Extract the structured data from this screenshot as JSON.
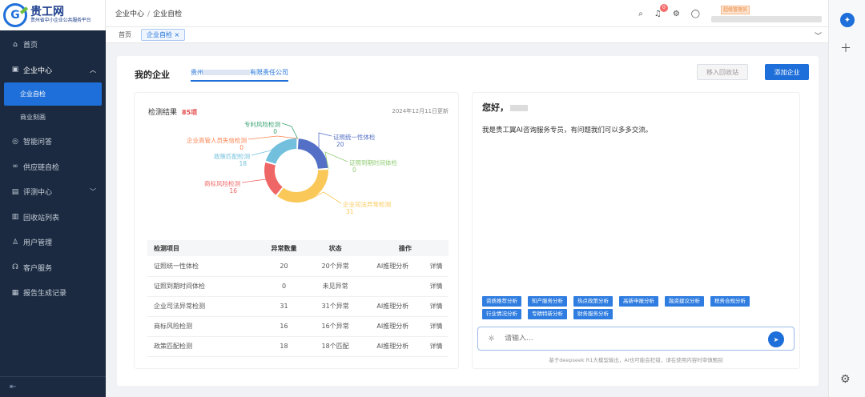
{
  "app": {
    "logo_title": "贵工网",
    "logo_sub": "贵州省中小企业公共服务平台"
  },
  "sidebar": {
    "items": [
      {
        "label": "首页",
        "icon": "home-icon"
      },
      {
        "label": "企业中心",
        "icon": "briefcase-icon"
      },
      {
        "label": "企业自检",
        "icon": ""
      },
      {
        "label": "商业刻画",
        "icon": ""
      },
      {
        "label": "智能问答",
        "icon": "chat-icon"
      },
      {
        "label": "供应链自检",
        "icon": "link-icon"
      },
      {
        "label": "评测中心",
        "icon": "document-icon"
      },
      {
        "label": "回收站列表",
        "icon": "trash-icon"
      },
      {
        "label": "用户管理",
        "icon": "user-icon"
      },
      {
        "label": "客户服务",
        "icon": "headset-icon"
      },
      {
        "label": "报告生成记录",
        "icon": "report-icon"
      }
    ]
  },
  "topbar": {
    "breadcrumb": [
      "企业中心",
      "企业自检"
    ],
    "notification_count": "0",
    "role": "超级管理员"
  },
  "tabs": [
    "首页",
    "企业自检"
  ],
  "main": {
    "section_title": "我的企业",
    "company_prefix": "贵州",
    "company_suffix": "有限责任公司",
    "recycle_btn": "移入回收站",
    "add_btn": "添加企业"
  },
  "result": {
    "title": "检测结果",
    "total": "85项",
    "updated": "2024年12月11日更新",
    "table_headers": [
      "检测项目",
      "异常数量",
      "状态",
      "操作"
    ],
    "rows": [
      {
        "item": "证照统一性体检",
        "count": "20",
        "status": "20个异常",
        "status_type": "red",
        "action": "AI推理分析",
        "detail": "详情"
      },
      {
        "item": "证照到期时间体检",
        "count": "0",
        "status": "未见异常",
        "status_type": "green",
        "action": "",
        "detail": "详情"
      },
      {
        "item": "企业司法异常检测",
        "count": "31",
        "status": "31个异常",
        "status_type": "red",
        "action": "AI推理分析",
        "detail": "详情"
      },
      {
        "item": "商标风险检测",
        "count": "16",
        "status": "16个异常",
        "status_type": "red",
        "action": "AI推理分析",
        "detail": "详情"
      },
      {
        "item": "政策匹配检测",
        "count": "18",
        "status": "18个匹配",
        "status_type": "red",
        "action": "AI推理分析",
        "detail": "详情"
      }
    ]
  },
  "chart_data": {
    "type": "pie",
    "subtype": "donut",
    "categories": [
      "证照统一性体检",
      "证照到期时间体检",
      "企业司法异常检测",
      "商标风险检测",
      "政策匹配检测",
      "企业高管人员失信检测",
      "专利风险检测"
    ],
    "values": [
      20,
      0,
      31,
      16,
      18,
      0,
      0
    ],
    "colors": [
      "#5470c6",
      "#91cc75",
      "#fac858",
      "#ee6666",
      "#73c0de",
      "#fc8452",
      "#3ba272"
    ]
  },
  "assistant": {
    "greeting": "您好，",
    "intro": "我是贵工翼AI咨询服务专员，有问题我们可以多多交流。",
    "chips": [
      "资质推荐分析",
      "知产服务分析",
      "热点政策分析",
      "高新申报分析",
      "融资建议分析",
      "税务合规分析",
      "行业情况分析",
      "专精特新分析",
      "财务服务分析"
    ],
    "placeholder": "请输入...",
    "disclaimer": "基于deepseek R1大模型输出，AI也可能会犯错，请在使用内容时审慎甄别"
  }
}
